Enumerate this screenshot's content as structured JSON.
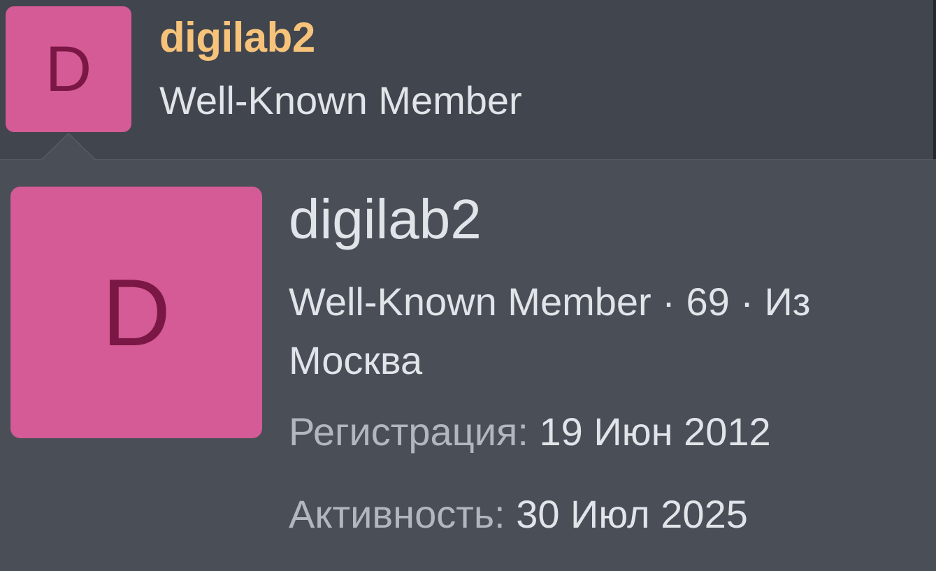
{
  "colors": {
    "avatar_bg": "#d45b95",
    "avatar_letter": "#7a1744",
    "username_accent": "#f7c37b",
    "header_bg": "#41454d",
    "popup_bg": "#494e57"
  },
  "header": {
    "avatar_letter": "D",
    "username": "digilab2",
    "user_title": "Well-Known Member"
  },
  "member_card": {
    "avatar_letter": "D",
    "username": "digilab2",
    "meta": {
      "title": "Well-Known Member",
      "sep1": " · ",
      "age": "69",
      "sep2": " · ",
      "location_prefix": "Из",
      "location": "Москва"
    },
    "stats": [
      {
        "label": "Регистрация:",
        "value": "19 Июн 2012"
      },
      {
        "label": "Активность:",
        "value": "30 Июл 2025"
      }
    ]
  }
}
